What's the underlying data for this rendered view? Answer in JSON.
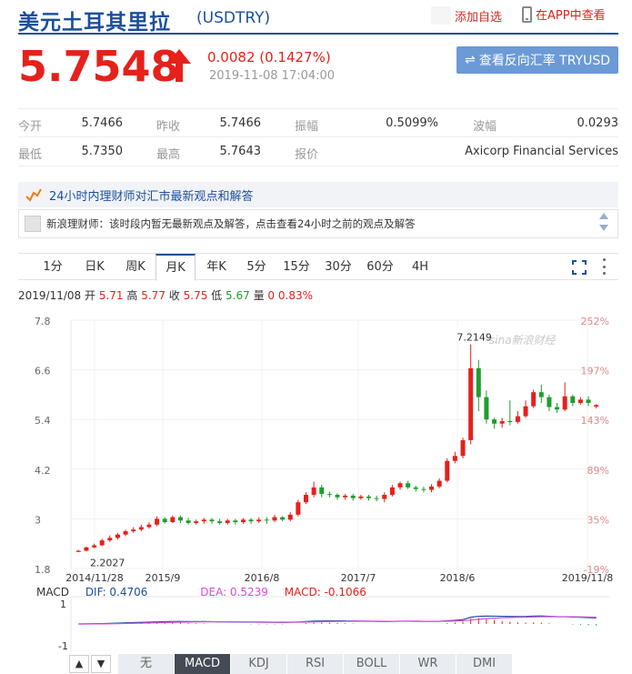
{
  "header": {
    "title": "美元土耳其里拉",
    "code": "(USDTRY)",
    "add_fav": "添加自选",
    "app_view": "在APP中查看",
    "price": "5.7548",
    "change": "0.0082 (0.1427%)",
    "timestamp": "2019-11-08 17:04:00",
    "reverse_btn": "查看反向汇率 TRYUSD",
    "up_color": "#e4211b",
    "brand_color": "#1b4f9c"
  },
  "stats": {
    "open_label": "今开",
    "open": "5.7466",
    "prev_label": "昨收",
    "prev": "5.7466",
    "amp_label": "振幅",
    "amp": "0.5099%",
    "wave_label": "波幅",
    "wave": "0.0293",
    "low_label": "最低",
    "low": "5.7350",
    "high_label": "最高",
    "high": "5.7643",
    "quote_label": "报价",
    "quote": "Axicorp Financial Services"
  },
  "news": {
    "bar_text": "24小时内理财师对汇市最新观点和解答",
    "row_text": "新浪理财师：该时段内暂无最新观点及解答，点击查看24小时之前的观点及解答"
  },
  "tabs": [
    "1分",
    "日K",
    "周K",
    "月K",
    "年K",
    "5分",
    "15分",
    "30分",
    "60分",
    "4H"
  ],
  "active_tab": "月K",
  "ohlc": {
    "date": "2019/11/08",
    "open_label": "开",
    "open": "5.71",
    "high_label": "高",
    "high": "5.77",
    "close_label": "收",
    "close": "5.75",
    "low_label": "低",
    "low": "5.67",
    "vol_label": "量",
    "vol": "0",
    "pct": "0.83%"
  },
  "watermark": "sina新浪财经",
  "chart_data": {
    "type": "candlestick",
    "y_ticks": [
      "7.8",
      "6.6",
      "5.4",
      "4.2",
      "3",
      "1.8"
    ],
    "pct_ticks": [
      "252%",
      "197%",
      "143%",
      "89%",
      "35%",
      "-19%"
    ],
    "x_ticks": [
      "2014/11/28",
      "2015/9",
      "2016/8",
      "2017/7",
      "2018/6",
      "2019/11/8"
    ],
    "ylim": [
      1.8,
      7.8
    ],
    "max_label": "7.2149",
    "min_label": "2.2027",
    "candles": [
      [
        2.2,
        2.23,
        2.22,
        2.25
      ],
      [
        2.23,
        2.31,
        2.21,
        2.33
      ],
      [
        2.31,
        2.36,
        2.29,
        2.4
      ],
      [
        2.36,
        2.48,
        2.34,
        2.52
      ],
      [
        2.48,
        2.54,
        2.44,
        2.6
      ],
      [
        2.54,
        2.62,
        2.5,
        2.66
      ],
      [
        2.62,
        2.7,
        2.58,
        2.74
      ],
      [
        2.7,
        2.74,
        2.66,
        2.8
      ],
      [
        2.74,
        2.8,
        2.7,
        2.86
      ],
      [
        2.8,
        2.86,
        2.76,
        2.92
      ],
      [
        2.86,
        3.0,
        2.82,
        3.06
      ],
      [
        3.0,
        2.92,
        2.88,
        3.04
      ],
      [
        2.92,
        3.04,
        2.9,
        3.08
      ],
      [
        3.04,
        2.96,
        2.9,
        3.08
      ],
      [
        2.96,
        2.9,
        2.86,
        3.02
      ],
      [
        2.9,
        2.94,
        2.86,
        2.98
      ],
      [
        2.94,
        2.98,
        2.88,
        3.02
      ],
      [
        2.98,
        2.94,
        2.88,
        3.02
      ],
      [
        2.94,
        2.9,
        2.86,
        3.0
      ],
      [
        2.9,
        2.96,
        2.86,
        3.0
      ],
      [
        2.96,
        2.92,
        2.86,
        3.0
      ],
      [
        2.92,
        2.98,
        2.88,
        3.02
      ],
      [
        2.98,
        2.94,
        2.88,
        3.02
      ],
      [
        2.94,
        2.98,
        2.9,
        3.04
      ],
      [
        2.98,
        2.96,
        2.88,
        3.04
      ],
      [
        2.96,
        3.04,
        2.92,
        3.1
      ],
      [
        3.04,
        2.98,
        2.94,
        3.06
      ],
      [
        2.98,
        3.1,
        2.94,
        3.16
      ],
      [
        3.1,
        3.4,
        3.06,
        3.46
      ],
      [
        3.4,
        3.58,
        3.36,
        3.64
      ],
      [
        3.58,
        3.76,
        3.52,
        3.9
      ],
      [
        3.76,
        3.6,
        3.52,
        3.82
      ],
      [
        3.6,
        3.58,
        3.52,
        3.66
      ],
      [
        3.58,
        3.52,
        3.46,
        3.62
      ],
      [
        3.52,
        3.56,
        3.46,
        3.6
      ],
      [
        3.56,
        3.5,
        3.44,
        3.6
      ],
      [
        3.5,
        3.54,
        3.46,
        3.58
      ],
      [
        3.54,
        3.5,
        3.44,
        3.58
      ],
      [
        3.5,
        3.48,
        3.42,
        3.56
      ],
      [
        3.48,
        3.58,
        3.4,
        3.64
      ],
      [
        3.58,
        3.76,
        3.54,
        3.82
      ],
      [
        3.76,
        3.86,
        3.7,
        3.9
      ],
      [
        3.86,
        3.76,
        3.72,
        3.92
      ],
      [
        3.76,
        3.72,
        3.66,
        3.8
      ],
      [
        3.72,
        3.7,
        3.64,
        3.78
      ],
      [
        3.7,
        3.78,
        3.64,
        3.84
      ],
      [
        3.78,
        3.92,
        3.74,
        3.98
      ],
      [
        3.92,
        4.4,
        3.88,
        4.46
      ],
      [
        4.4,
        4.52,
        4.34,
        4.62
      ],
      [
        4.52,
        4.9,
        4.46,
        4.96
      ],
      [
        4.9,
        6.64,
        4.8,
        7.2149
      ],
      [
        6.64,
        5.94,
        5.6,
        6.84
      ],
      [
        5.94,
        5.4,
        5.3,
        6.1
      ],
      [
        5.4,
        5.3,
        5.18,
        5.44
      ],
      [
        5.3,
        5.36,
        5.2,
        5.44
      ],
      [
        5.36,
        5.34,
        5.26,
        5.86
      ],
      [
        5.34,
        5.48,
        5.3,
        5.6
      ],
      [
        5.48,
        5.72,
        5.44,
        5.86
      ],
      [
        5.72,
        6.06,
        5.68,
        6.12
      ],
      [
        6.06,
        5.94,
        5.8,
        6.24
      ],
      [
        5.94,
        5.7,
        5.6,
        6.0
      ],
      [
        5.7,
        5.64,
        5.56,
        5.8
      ],
      [
        5.64,
        5.96,
        5.6,
        6.3
      ],
      [
        5.96,
        5.8,
        5.72,
        6.0
      ],
      [
        5.8,
        5.88,
        5.76,
        5.94
      ],
      [
        5.88,
        5.8,
        5.72,
        5.96
      ],
      [
        5.71,
        5.75,
        5.67,
        5.77
      ]
    ]
  },
  "macd": {
    "label": "MACD",
    "dif": "DIF: 0.4706",
    "dea": "DEA: 0.5239",
    "macd": "MACD: -0.1066",
    "ticks": [
      "1",
      "-1"
    ]
  },
  "indicators": [
    "无",
    "MACD",
    "KDJ",
    "RSI",
    "BOLL",
    "WR",
    "DMI"
  ],
  "active_indicator": "MACD"
}
